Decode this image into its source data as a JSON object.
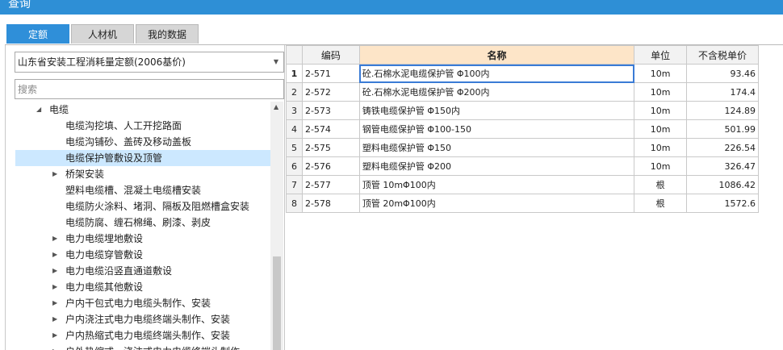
{
  "window": {
    "title": "查询"
  },
  "tabs": [
    {
      "label": "定额",
      "active": true
    },
    {
      "label": "人材机",
      "active": false
    },
    {
      "label": "我的数据",
      "active": false
    }
  ],
  "left": {
    "quota_select": "山东省安装工程消耗量定额(2006基价)",
    "search_placeholder": "搜索",
    "tree": [
      {
        "label": "电缆",
        "level": 1,
        "toggle": "expanded"
      },
      {
        "label": "电缆沟挖填、人工开挖路面",
        "level": 2,
        "toggle": "none"
      },
      {
        "label": "电缆沟铺砂、盖砖及移动盖板",
        "level": 2,
        "toggle": "none"
      },
      {
        "label": "电缆保护管敷设及顶管",
        "level": 2,
        "toggle": "none",
        "selected": true
      },
      {
        "label": "桥架安装",
        "level": 2,
        "toggle": "collapsed"
      },
      {
        "label": "塑料电缆槽、混凝土电缆槽安装",
        "level": 2,
        "toggle": "none"
      },
      {
        "label": "电缆防火涂料、堵洞、隔板及阻燃槽盒安装",
        "level": 2,
        "toggle": "none"
      },
      {
        "label": "电缆防腐、缠石棉绳、刷漆、剥皮",
        "level": 2,
        "toggle": "none"
      },
      {
        "label": "电力电缆埋地敷设",
        "level": 2,
        "toggle": "collapsed"
      },
      {
        "label": "电力电缆穿管敷设",
        "level": 2,
        "toggle": "collapsed"
      },
      {
        "label": "电力电缆沿竖直通道敷设",
        "level": 2,
        "toggle": "collapsed"
      },
      {
        "label": "电力电缆其他敷设",
        "level": 2,
        "toggle": "collapsed"
      },
      {
        "label": "户内干包式电力电缆头制作、安装",
        "level": 2,
        "toggle": "collapsed"
      },
      {
        "label": "户内浇注式电力电缆终端头制作、安装",
        "level": 2,
        "toggle": "collapsed"
      },
      {
        "label": "户内热缩式电力电缆终端头制作、安装",
        "level": 2,
        "toggle": "collapsed"
      },
      {
        "label": "户外热缩式、浇注式电力电缆终端头制作",
        "level": 2,
        "toggle": "collapsed"
      }
    ]
  },
  "table": {
    "columns": [
      "编码",
      "名称",
      "单位",
      "不含税单价"
    ],
    "rows": [
      {
        "no": "1",
        "code": "2-571",
        "name": "砼.石棉水泥电缆保护管 Φ100内",
        "unit": "10m",
        "price": "93.46"
      },
      {
        "no": "2",
        "code": "2-572",
        "name": "砼.石棉水泥电缆保护管 Φ200内",
        "unit": "10m",
        "price": "174.4"
      },
      {
        "no": "3",
        "code": "2-573",
        "name": "铸铁电缆保护管 Φ150内",
        "unit": "10m",
        "price": "124.89"
      },
      {
        "no": "4",
        "code": "2-574",
        "name": "钢管电缆保护管 Φ100-150",
        "unit": "10m",
        "price": "501.99"
      },
      {
        "no": "5",
        "code": "2-575",
        "name": "塑料电缆保护管 Φ150",
        "unit": "10m",
        "price": "226.54"
      },
      {
        "no": "6",
        "code": "2-576",
        "name": "塑料电缆保护管 Φ200",
        "unit": "10m",
        "price": "326.47"
      },
      {
        "no": "7",
        "code": "2-577",
        "name": "顶管 10mΦ100内",
        "unit": "根",
        "price": "1086.42"
      },
      {
        "no": "8",
        "code": "2-578",
        "name": "顶管 20mΦ100内",
        "unit": "根",
        "price": "1572.6"
      }
    ]
  },
  "icons": {
    "dropdown": "chevron-down-icon",
    "expanded": "triangle-expanded-icon",
    "collapsed": "triangle-collapsed-icon",
    "scroll_up": "scroll-up-icon"
  },
  "colors": {
    "accent": "#2f8fd9",
    "selection": "#cce8ff",
    "header_highlight": "#fde5c8"
  }
}
